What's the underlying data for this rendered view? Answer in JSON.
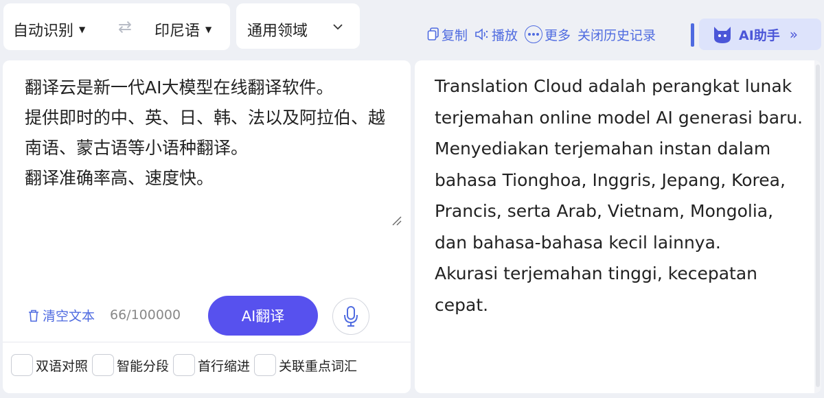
{
  "lang_bar": {
    "source_lang": "自动识别",
    "target_lang": "印尼语",
    "domain": "通用领域"
  },
  "toolbar": {
    "copy": "复制",
    "play": "播放",
    "more": "更多",
    "close_history": "关闭历史记录",
    "ai_helper": "AI助手"
  },
  "input": {
    "text": "翻译云是新一代AI大模型在线翻译软件。\n提供即时的中、英、日、韩、法以及阿拉伯、越南语、蒙古语等小语种翻译。\n翻译准确率高、速度快。",
    "clear": "清空文本",
    "count": "66/100000",
    "translate": "AI翻译"
  },
  "options": [
    "双语对照",
    "智能分段",
    "首行缩进",
    "关联重点词汇"
  ],
  "output": {
    "text": "Translation Cloud adalah perangkat lunak terjemahan online model AI generasi baru.\nMenyediakan terjemahan instan dalam bahasa Tionghoa, Inggris, Jepang, Korea, Prancis, serta Arab, Vietnam, Mongolia, dan bahasa-bahasa kecil lainnya.\nAkurasi terjemahan tinggi, kecepatan cepat."
  },
  "colors": {
    "accent": "#4f6be0",
    "primary_button": "#5751ee",
    "helper_bg": "#dde3fb",
    "page_bg": "#eef0f5"
  }
}
